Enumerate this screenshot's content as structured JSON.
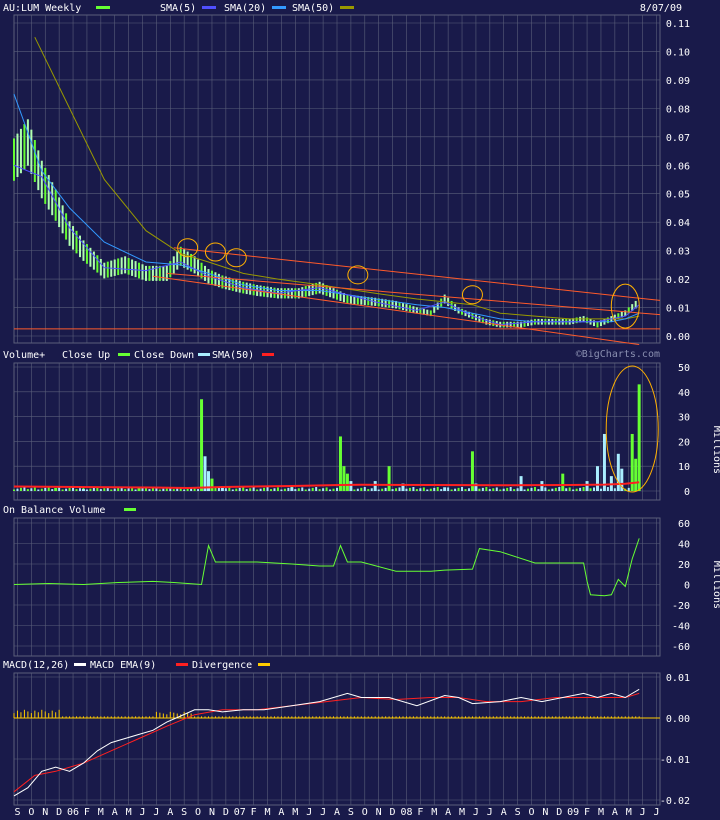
{
  "header": {
    "title": "AU:LUM Weekly",
    "date": "8/07/09",
    "legend": [
      {
        "label": "SMA(5)",
        "color": "#5050ff"
      },
      {
        "label": "SMA(20)",
        "color": "#3399ff"
      },
      {
        "label": "SMA(50)",
        "color": "#999900"
      }
    ],
    "title_swatch": "#66ff33"
  },
  "watermark": "©BigCharts.com",
  "colors": {
    "background": "#191a4a",
    "grid": "#5a5f7a",
    "price_bar": "#b0ffb0",
    "price_bar_alt": "#66ff33",
    "sma5": "#5050ff",
    "sma20": "#3399ff",
    "sma50": "#999900",
    "trendline": "#ff5a2a",
    "highlight": "#ffb000",
    "vol_up": "#66ff33",
    "vol_down": "#aaeeff",
    "vol_sma": "#ff2020",
    "obv": "#66ff33",
    "macd": "#ffffff",
    "macd_ema": "#ff2020",
    "divergence": "#ffcc00"
  },
  "chart_data": [
    {
      "type": "line",
      "name": "price",
      "title": "AU:LUM Weekly",
      "ylim": [
        0,
        0.11
      ],
      "yticks": [
        "0.00",
        "0.01",
        "0.02",
        "0.03",
        "0.04",
        "0.05",
        "0.06",
        "0.07",
        "0.08",
        "0.09",
        "0.10",
        "0.11"
      ],
      "series": [
        {
          "name": "price",
          "x": [
            0,
            4,
            8,
            12,
            16,
            20,
            26,
            32,
            38,
            44,
            48,
            52,
            56,
            60,
            66,
            70,
            76,
            82,
            88,
            96,
            104,
            110,
            116,
            120,
            124,
            128,
            132,
            136,
            140,
            146,
            150,
            156,
            160,
            164,
            168,
            170,
            172,
            174,
            176,
            180
          ],
          "values": [
            0.062,
            0.068,
            0.055,
            0.046,
            0.036,
            0.03,
            0.023,
            0.025,
            0.022,
            0.022,
            0.028,
            0.025,
            0.021,
            0.019,
            0.017,
            0.016,
            0.015,
            0.015,
            0.017,
            0.013,
            0.012,
            0.011,
            0.009,
            0.008,
            0.013,
            0.009,
            0.007,
            0.005,
            0.004,
            0.004,
            0.005,
            0.005,
            0.005,
            0.006,
            0.004,
            0.005,
            0.006,
            0.007,
            0.008,
            0.012
          ]
        },
        {
          "name": "SMA(5)",
          "x": [
            0,
            8,
            16,
            26,
            38,
            48,
            56,
            66,
            76,
            88,
            104,
            116,
            124,
            132,
            140,
            150,
            160,
            168,
            172,
            176,
            180
          ],
          "values": [
            0.06,
            0.056,
            0.038,
            0.024,
            0.023,
            0.026,
            0.021,
            0.017,
            0.015,
            0.017,
            0.012,
            0.009,
            0.012,
            0.007,
            0.004,
            0.005,
            0.005,
            0.005,
            0.006,
            0.007,
            0.011
          ]
        },
        {
          "name": "SMA(20)",
          "x": [
            0,
            8,
            16,
            26,
            38,
            48,
            56,
            66,
            76,
            88,
            104,
            116,
            124,
            132,
            140,
            150,
            160,
            168,
            172,
            176,
            180
          ],
          "values": [
            0.085,
            0.058,
            0.045,
            0.033,
            0.026,
            0.025,
            0.022,
            0.018,
            0.016,
            0.016,
            0.013,
            0.011,
            0.01,
            0.008,
            0.006,
            0.005,
            0.005,
            0.005,
            0.005,
            0.006,
            0.008
          ]
        },
        {
          "name": "SMA(50)",
          "x": [
            6,
            16,
            26,
            38,
            48,
            56,
            66,
            76,
            88,
            104,
            116,
            124,
            132,
            140,
            150,
            160,
            168,
            176,
            180
          ],
          "values": [
            0.105,
            0.08,
            0.055,
            0.037,
            0.029,
            0.026,
            0.022,
            0.02,
            0.018,
            0.015,
            0.013,
            0.012,
            0.011,
            0.008,
            0.007,
            0.006,
            0.006,
            0.006,
            0.007
          ]
        }
      ]
    },
    {
      "type": "bar",
      "name": "volume",
      "legend": [
        "Volume+",
        "Close Up",
        "Close Down",
        "SMA(50)"
      ],
      "ylim": [
        0,
        50
      ],
      "yticks": [
        "0",
        "10",
        "20",
        "30",
        "40",
        "50"
      ],
      "ylabel": "Millions",
      "bars": [
        {
          "x": 12,
          "value": 1.2,
          "dir": "up"
        },
        {
          "x": 20,
          "value": 0.8,
          "dir": "down"
        },
        {
          "x": 36,
          "value": 1.5,
          "dir": "up"
        },
        {
          "x": 54,
          "value": 37,
          "dir": "up"
        },
        {
          "x": 55,
          "value": 14,
          "dir": "down"
        },
        {
          "x": 56,
          "value": 8,
          "dir": "down"
        },
        {
          "x": 57,
          "value": 5,
          "dir": "up"
        },
        {
          "x": 60,
          "value": 2,
          "dir": "down"
        },
        {
          "x": 80,
          "value": 1.5,
          "dir": "down"
        },
        {
          "x": 94,
          "value": 22,
          "dir": "up"
        },
        {
          "x": 95,
          "value": 10,
          "dir": "up"
        },
        {
          "x": 96,
          "value": 7,
          "dir": "up"
        },
        {
          "x": 97,
          "value": 4,
          "dir": "down"
        },
        {
          "x": 104,
          "value": 4,
          "dir": "down"
        },
        {
          "x": 108,
          "value": 10,
          "dir": "up"
        },
        {
          "x": 112,
          "value": 3,
          "dir": "down"
        },
        {
          "x": 124,
          "value": 1.5,
          "dir": "down"
        },
        {
          "x": 132,
          "value": 16,
          "dir": "up"
        },
        {
          "x": 133,
          "value": 3,
          "dir": "down"
        },
        {
          "x": 146,
          "value": 6,
          "dir": "down"
        },
        {
          "x": 152,
          "value": 4,
          "dir": "down"
        },
        {
          "x": 158,
          "value": 7,
          "dir": "up"
        },
        {
          "x": 165,
          "value": 4,
          "dir": "down"
        },
        {
          "x": 168,
          "value": 10,
          "dir": "down"
        },
        {
          "x": 170,
          "value": 23,
          "dir": "down"
        },
        {
          "x": 172,
          "value": 6,
          "dir": "down"
        },
        {
          "x": 174,
          "value": 15,
          "dir": "down"
        },
        {
          "x": 175,
          "value": 9,
          "dir": "down"
        },
        {
          "x": 178,
          "value": 23,
          "dir": "up"
        },
        {
          "x": 179,
          "value": 13,
          "dir": "up"
        },
        {
          "x": 180,
          "value": 43,
          "dir": "up"
        }
      ],
      "sma": {
        "x": [
          0,
          40,
          50,
          60,
          80,
          94,
          100,
          120,
          140,
          160,
          170,
          176,
          180
        ],
        "values": [
          1.8,
          1.4,
          1.2,
          1.6,
          2.0,
          2.4,
          2.5,
          2.4,
          2.3,
          2.4,
          2.6,
          2.9,
          3.5
        ]
      }
    },
    {
      "type": "line",
      "name": "obv",
      "title": "On Balance Volume",
      "ylim": [
        -60,
        60
      ],
      "yticks": [
        "-60",
        "-40",
        "-20",
        "0",
        "20",
        "40",
        "60"
      ],
      "ylabel": "Millions",
      "series": [
        {
          "name": "On Balance Volume",
          "x": [
            0,
            10,
            20,
            30,
            40,
            46,
            50,
            54,
            56,
            58,
            70,
            80,
            88,
            92,
            94,
            96,
            100,
            110,
            120,
            124,
            132,
            134,
            140,
            150,
            160,
            164,
            165,
            166,
            170,
            172,
            174,
            176,
            178,
            180
          ],
          "values": [
            0,
            1,
            0,
            2,
            3,
            2,
            1,
            0,
            38,
            22,
            22,
            20,
            18,
            18,
            38,
            22,
            22,
            13,
            13,
            14,
            15,
            35,
            32,
            21,
            21,
            21,
            3,
            -10,
            -11,
            -10,
            5,
            -2,
            25,
            45
          ]
        }
      ]
    },
    {
      "type": "line",
      "name": "macd",
      "legend": [
        "MACD(12,26)",
        "MACD EMA(9)",
        "Divergence"
      ],
      "ylim": [
        -0.02,
        0.01
      ],
      "yticks": [
        "-0.02",
        "-0.01",
        "0.00",
        "0.01"
      ],
      "series": [
        {
          "name": "MACD",
          "x": [
            0,
            4,
            8,
            12,
            16,
            20,
            24,
            28,
            32,
            36,
            40,
            44,
            48,
            52,
            56,
            60,
            66,
            72,
            80,
            88,
            96,
            100,
            108,
            116,
            124,
            128,
            132,
            140,
            146,
            152,
            158,
            164,
            168,
            172,
            176,
            180
          ],
          "values": [
            -0.019,
            -0.017,
            -0.013,
            -0.012,
            -0.013,
            -0.011,
            -0.008,
            -0.006,
            -0.005,
            -0.004,
            -0.003,
            -0.001,
            0.0005,
            0.002,
            0.002,
            0.0015,
            0.002,
            0.002,
            0.003,
            0.004,
            0.006,
            0.005,
            0.005,
            0.003,
            0.0055,
            0.005,
            0.0035,
            0.004,
            0.005,
            0.004,
            0.005,
            0.006,
            0.005,
            0.006,
            0.005,
            0.007
          ]
        },
        {
          "name": "MACD EMA(9)",
          "x": [
            0,
            6,
            12,
            20,
            28,
            36,
            44,
            52,
            60,
            70,
            80,
            90,
            100,
            110,
            120,
            128,
            136,
            146,
            156,
            166,
            176,
            180
          ],
          "values": [
            -0.018,
            -0.014,
            -0.013,
            -0.011,
            -0.008,
            -0.005,
            -0.002,
            0.0008,
            0.002,
            0.002,
            0.003,
            0.004,
            0.005,
            0.0045,
            0.005,
            0.005,
            0.004,
            0.004,
            0.005,
            0.005,
            0.005,
            0.006
          ]
        },
        {
          "name": "Divergence",
          "x": [
            0,
            180
          ],
          "values": [
            0,
            0
          ]
        }
      ]
    }
  ],
  "x_axis": {
    "labels": [
      {
        "x": 1,
        "t": "S"
      },
      {
        "x": 5,
        "t": "O"
      },
      {
        "x": 9,
        "t": "N"
      },
      {
        "x": 13,
        "t": "D"
      },
      {
        "x": 17,
        "t": "06"
      },
      {
        "x": 21,
        "t": "F"
      },
      {
        "x": 25,
        "t": "M"
      },
      {
        "x": 29,
        "t": "A"
      },
      {
        "x": 33,
        "t": "M"
      },
      {
        "x": 37,
        "t": "J"
      },
      {
        "x": 41,
        "t": "J"
      },
      {
        "x": 45,
        "t": "A"
      },
      {
        "x": 49,
        "t": "S"
      },
      {
        "x": 53,
        "t": "O"
      },
      {
        "x": 57,
        "t": "N"
      },
      {
        "x": 61,
        "t": "D"
      },
      {
        "x": 65,
        "t": "07"
      },
      {
        "x": 69,
        "t": "F"
      },
      {
        "x": 73,
        "t": "M"
      },
      {
        "x": 77,
        "t": "A"
      },
      {
        "x": 81,
        "t": "M"
      },
      {
        "x": 85,
        "t": "J"
      },
      {
        "x": 89,
        "t": "J"
      },
      {
        "x": 93,
        "t": "A"
      },
      {
        "x": 97,
        "t": "S"
      },
      {
        "x": 101,
        "t": "O"
      },
      {
        "x": 105,
        "t": "N"
      },
      {
        "x": 109,
        "t": "D"
      },
      {
        "x": 113,
        "t": "08"
      },
      {
        "x": 117,
        "t": "F"
      },
      {
        "x": 121,
        "t": "M"
      },
      {
        "x": 125,
        "t": "A"
      },
      {
        "x": 129,
        "t": "M"
      },
      {
        "x": 133,
        "t": "J"
      },
      {
        "x": 137,
        "t": "J"
      },
      {
        "x": 141,
        "t": "A"
      },
      {
        "x": 145,
        "t": "S"
      },
      {
        "x": 149,
        "t": "O"
      },
      {
        "x": 153,
        "t": "N"
      },
      {
        "x": 157,
        "t": "D"
      },
      {
        "x": 161,
        "t": "09"
      },
      {
        "x": 165,
        "t": "F"
      },
      {
        "x": 169,
        "t": "M"
      },
      {
        "x": 173,
        "t": "A"
      },
      {
        "x": 177,
        "t": "M"
      },
      {
        "x": 181,
        "t": "J"
      },
      {
        "x": 185,
        "t": "J"
      }
    ]
  }
}
